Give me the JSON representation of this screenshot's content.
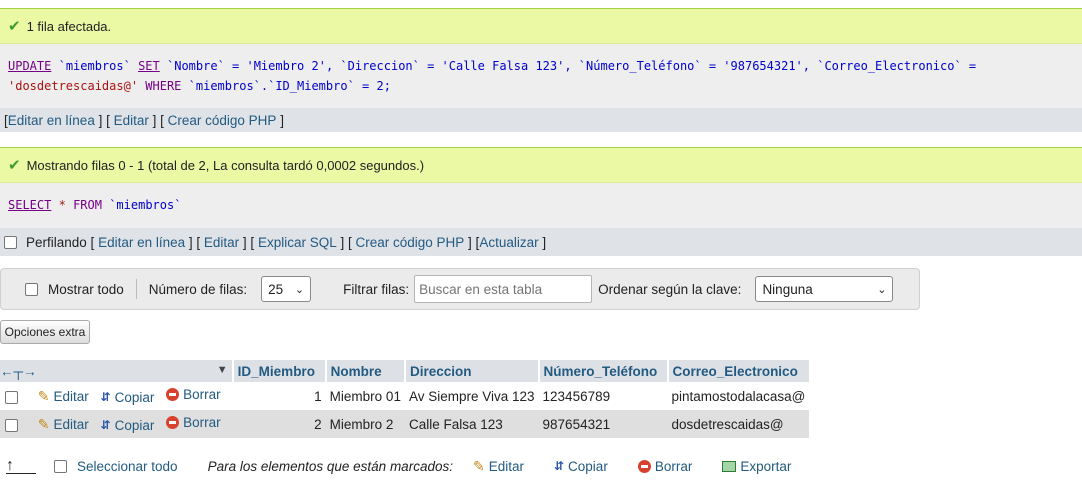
{
  "update_msg": {
    "success_text": "1 fila afectada.",
    "sql_part1_kw_update": "UPDATE",
    "sql_part1_table": "`miembros`",
    "sql_part1_kw_set": "SET",
    "sql_line1_rest": "`Nombre` = 'Miembro 2', `Direccion` = 'Calle Falsa 123', `Número_Teléfono` = '987654321', `Correo_Electronico` =",
    "sql_line2_str": "'dosdetrescaidas@'",
    "sql_line2_where": "WHERE",
    "sql_line2_rest": "`miembros`.`ID_Miembro` = 2;",
    "links": [
      "Editar en línea",
      "Editar",
      "Crear código PHP"
    ]
  },
  "select_msg": {
    "success_text": "Mostrando filas 0 - 1 (total de 2, La consulta tardó 0,0002 segundos.)",
    "sql_kw_select": "SELECT",
    "sql_star": "*",
    "sql_from": "FROM",
    "sql_table": "`miembros`",
    "profiling_label": "Perfilando",
    "links": [
      "Editar en línea",
      "Editar",
      "Explicar SQL",
      "Crear código PHP",
      "Actualizar"
    ]
  },
  "nav": {
    "show_all_label": "Mostrar todo",
    "rows_label": "Número de filas:",
    "rows_value": "25",
    "filter_label": "Filtrar filas:",
    "filter_placeholder": "Buscar en esta tabla",
    "sort_label": "Ordenar según la clave:",
    "sort_value": "Ninguna"
  },
  "extra_options_label": "Opciones extra",
  "table": {
    "columns": [
      "ID_Miembro",
      "Nombre",
      "Direccion",
      "Número_Teléfono",
      "Correo_Electronico"
    ],
    "actions": {
      "edit": "Editar",
      "copy": "Copiar",
      "delete": "Borrar"
    },
    "rows": [
      {
        "id": "1",
        "nombre": "Miembro 01",
        "direccion": "Av Siempre Viva 123",
        "telefono": "123456789",
        "correo": "pintamostodalacasa@"
      },
      {
        "id": "2",
        "nombre": "Miembro 2",
        "direccion": "Calle Falsa 123",
        "telefono": "987654321",
        "correo": "dosdetrescaidas@"
      }
    ]
  },
  "footer": {
    "select_all": "Seleccionar todo",
    "for_marked": "Para los elementos que están marcados:",
    "edit": "Editar",
    "copy": "Copiar",
    "delete": "Borrar",
    "export": "Exportar"
  },
  "colors": {
    "success_bg": "#ebf8a4",
    "link": "#235a81",
    "header_bg": "#dde1e6"
  }
}
